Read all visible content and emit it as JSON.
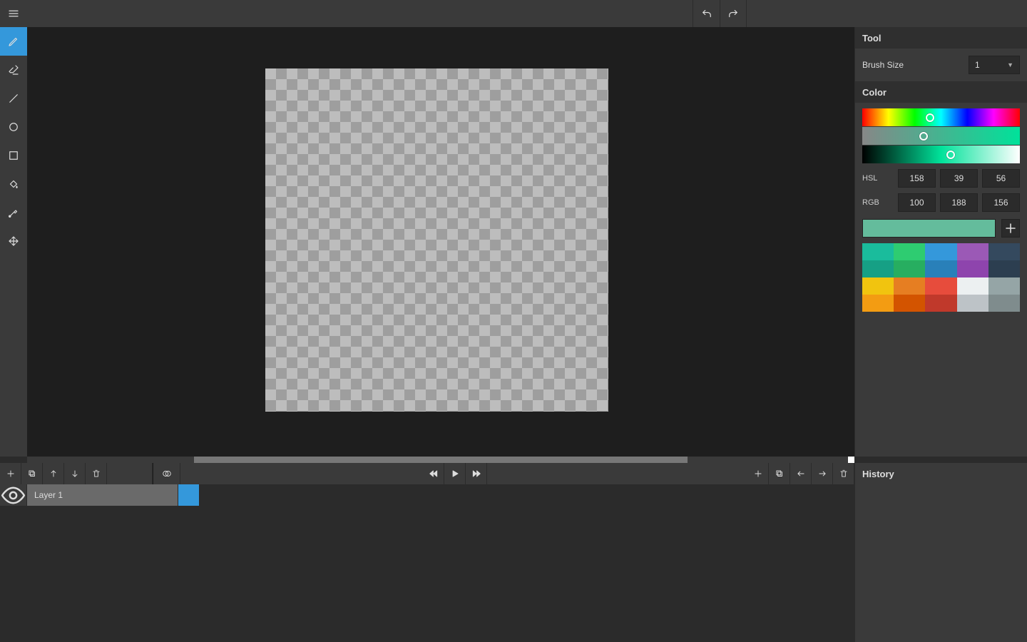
{
  "panels": {
    "tool_header": "Tool",
    "color_header": "Color",
    "history_header": "History"
  },
  "tool": {
    "brush_size_label": "Brush Size",
    "brush_size_value": "1"
  },
  "color": {
    "hsl_label": "HSL",
    "rgb_label": "RGB",
    "hsl": {
      "h": "158",
      "s": "39",
      "l": "56"
    },
    "rgb": {
      "r": "100",
      "g": "188",
      "b": "156"
    },
    "current_hex": "#64bc9c",
    "hue_knob_pct": 43,
    "sat_knob_pct": 39,
    "light_knob_pct": 56,
    "palette": [
      "#1abc9c",
      "#2ecc71",
      "#3498db",
      "#9b59b6",
      "#34495e",
      "#16a085",
      "#27ae60",
      "#2980b9",
      "#8e44ad",
      "#2c3e50",
      "#f1c40f",
      "#e67e22",
      "#e74c3c",
      "#ecf0f1",
      "#95a5a6",
      "#f39c12",
      "#d35400",
      "#c0392b",
      "#bdc3c7",
      "#7f8c8d"
    ]
  },
  "layers": {
    "layer1_name": "Layer 1"
  }
}
